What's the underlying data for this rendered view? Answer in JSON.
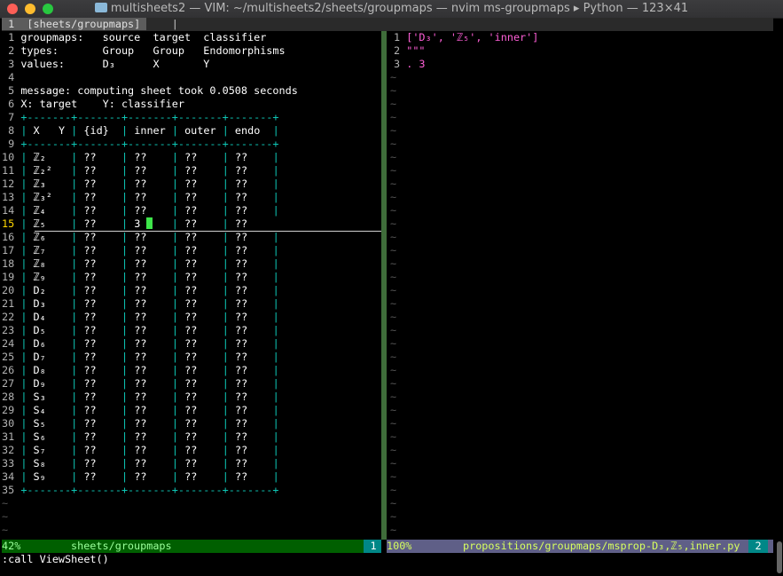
{
  "window": {
    "title": "multisheets2 — VIM: ~/multisheets2/sheets/groupmaps  — nvim ms-groupmaps ▸ Python — 123×41"
  },
  "tabline": {
    "tab": " 1  [sheets/groupmaps] ",
    "sep": "|"
  },
  "left": {
    "groupmaps": "groupmaps:   source  target  classifier",
    "types": "types:       Group   Group   Endomorphisms",
    "values": "values:      D₃      X       Y",
    "message": "message: computing sheet took 0.0508 seconds",
    "xy": "X: target    Y: classifier",
    "border": "+-------+-------+-------+-------+-------+",
    "headers": [
      "X   Y",
      "{id}",
      "inner",
      "outer",
      "endo"
    ],
    "rows": [
      [
        "ℤ₂",
        "??",
        "??",
        "??",
        "??"
      ],
      [
        "ℤ₂²",
        "??",
        "??",
        "??",
        "??"
      ],
      [
        "ℤ₃",
        "??",
        "??",
        "??",
        "??"
      ],
      [
        "ℤ₃²",
        "??",
        "??",
        "??",
        "??"
      ],
      [
        "ℤ₄",
        "??",
        "??",
        "??",
        "??"
      ],
      [
        "ℤ₅",
        "??",
        "3",
        "??",
        "??"
      ],
      [
        "ℤ₆",
        "??",
        "??",
        "??",
        "??"
      ],
      [
        "ℤ₇",
        "??",
        "??",
        "??",
        "??"
      ],
      [
        "ℤ₈",
        "??",
        "??",
        "??",
        "??"
      ],
      [
        "ℤ₉",
        "??",
        "??",
        "??",
        "??"
      ],
      [
        "D₂",
        "??",
        "??",
        "??",
        "??"
      ],
      [
        "D₃",
        "??",
        "??",
        "??",
        "??"
      ],
      [
        "D₄",
        "??",
        "??",
        "??",
        "??"
      ],
      [
        "D₅",
        "??",
        "??",
        "??",
        "??"
      ],
      [
        "D₆",
        "??",
        "??",
        "??",
        "??"
      ],
      [
        "D₇",
        "??",
        "??",
        "??",
        "??"
      ],
      [
        "D₈",
        "??",
        "??",
        "??",
        "??"
      ],
      [
        "D₉",
        "??",
        "??",
        "??",
        "??"
      ],
      [
        "S₃",
        "??",
        "??",
        "??",
        "??"
      ],
      [
        "S₄",
        "??",
        "??",
        "??",
        "??"
      ],
      [
        "S₅",
        "??",
        "??",
        "??",
        "??"
      ],
      [
        "S₆",
        "??",
        "??",
        "??",
        "??"
      ],
      [
        "S₇",
        "??",
        "??",
        "??",
        "??"
      ],
      [
        "S₈",
        "??",
        "??",
        "??",
        "??"
      ],
      [
        "S₉",
        "??",
        "??",
        "??",
        "??"
      ]
    ],
    "status": {
      "percent": "42%",
      "filename": "sheets/groupmaps",
      "window_number": "1"
    }
  },
  "right": {
    "line1": "['D₃', 'ℤ₅', 'inner']",
    "line2": "\"\"\"",
    "line3": ". 3",
    "status": {
      "percent": "100%",
      "filename": "propositions/groupmaps/msprop-D₃,ℤ₅,inner.py",
      "window_number": "2"
    }
  },
  "cmdline": ":call ViewSheet()",
  "colors": {
    "border": "#0ec7b6",
    "string": "#ff5fd7",
    "current_line_number": "#ffd700",
    "cursor": "#3ee54a",
    "left_status_bg": "#005f00",
    "right_status_bg": "#5f5f87"
  }
}
